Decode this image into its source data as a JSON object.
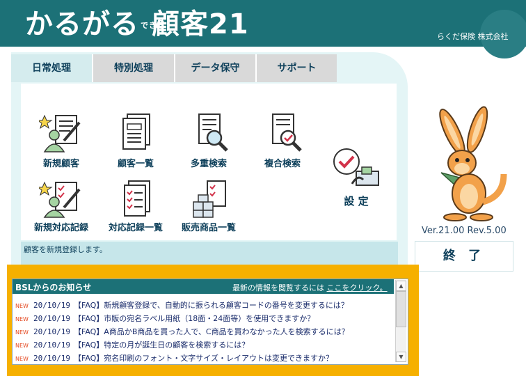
{
  "app": {
    "title_main": "かるがる",
    "title_small": "できる",
    "title_end": "顧客21",
    "company": "らくだ保険 株式会社"
  },
  "tabs": [
    {
      "label": "日常処理",
      "active": true
    },
    {
      "label": "特別処理",
      "active": false
    },
    {
      "label": "データ保守",
      "active": false
    },
    {
      "label": "サポート",
      "active": false
    }
  ],
  "menu": {
    "new_customer": "新規顧客",
    "customer_list": "顧客一覧",
    "multi_search": "多重検索",
    "compound_search": "複合検索",
    "new_record": "新規対応記録",
    "record_list": "対応記録一覧",
    "product_list": "販売商品一覧",
    "settings": "設 定"
  },
  "status_text": "顧客を新規登録します。",
  "version": "Ver.21.00 Rev.5.00",
  "exit_label": "終 了",
  "news": {
    "title": "BSLからのお知らせ",
    "link_prefix": "最新の情報を閲覧するには",
    "link_text": "ここをクリック。",
    "items": [
      {
        "badge": "NEW",
        "date": "20/10/19",
        "text": "【FAQ】新規顧客登録で、自動的に振られる顧客コードの番号を変更するには？"
      },
      {
        "badge": "NEW",
        "date": "20/10/19",
        "text": "【FAQ】市販の宛名ラベル用紙（18面・24面等）を使用できますか？"
      },
      {
        "badge": "NEW",
        "date": "20/10/19",
        "text": "【FAQ】A商品かB商品を買った人で、C商品を買わなかった人を検索するには？"
      },
      {
        "badge": "NEW",
        "date": "20/10/19",
        "text": "【FAQ】特定の月が誕生日の顧客を検索するには？"
      },
      {
        "badge": "NEW",
        "date": "20/10/19",
        "text": "【FAQ】宛名印刷のフォント・文字サイズ・レイアウトは変更できますか？"
      }
    ]
  },
  "colors": {
    "header": "#1c7177",
    "news_frame": "#f6b000",
    "accent_text": "#0d3f5a"
  }
}
